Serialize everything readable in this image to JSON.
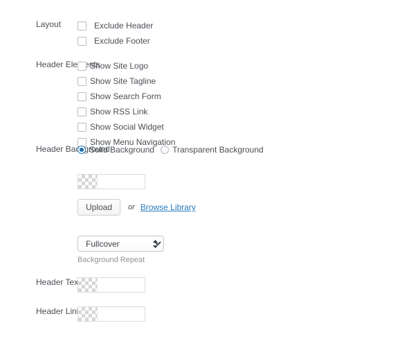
{
  "sections": {
    "layout": {
      "label": "Layout",
      "options": [
        {
          "label": "Exclude Header",
          "checked": false
        },
        {
          "label": "Exclude Footer",
          "checked": false
        }
      ]
    },
    "header_elements": {
      "label": "Header Elements",
      "options": [
        {
          "label": "Show Site Logo",
          "checked": false
        },
        {
          "label": "Show Site Tagline",
          "checked": false
        },
        {
          "label": "Show Search Form",
          "checked": false
        },
        {
          "label": "Show RSS Link",
          "checked": false
        },
        {
          "label": "Show Social Widget",
          "checked": false
        },
        {
          "label": "Show Menu Navigation",
          "checked": false
        }
      ]
    },
    "header_background": {
      "label": "Header Background",
      "options": [
        {
          "label": "Solid Background",
          "selected": true
        },
        {
          "label": "Transparent Background",
          "selected": false
        }
      ],
      "background_color": {
        "value": "",
        "placeholder": "",
        "swatch": "transparent"
      },
      "upload": {
        "button_label": "Upload",
        "or_label": "or",
        "browse_label": "Browse Library"
      },
      "repeat": {
        "selected": "Fullcover",
        "options": [
          "Fullcover"
        ],
        "helper": "Background Repeat"
      }
    },
    "header_text_color": {
      "label": "Header Text Color",
      "value": "",
      "placeholder": "",
      "swatch": "transparent"
    },
    "header_link_color": {
      "label": "Header Link Color",
      "value": "",
      "placeholder": "",
      "swatch": "transparent"
    }
  },
  "colors": {
    "text": "#4a4f55",
    "muted": "#8e9398",
    "link": "#2a7bbd",
    "radio_accent": "#1f6fae",
    "border": "#dcdcdc"
  }
}
